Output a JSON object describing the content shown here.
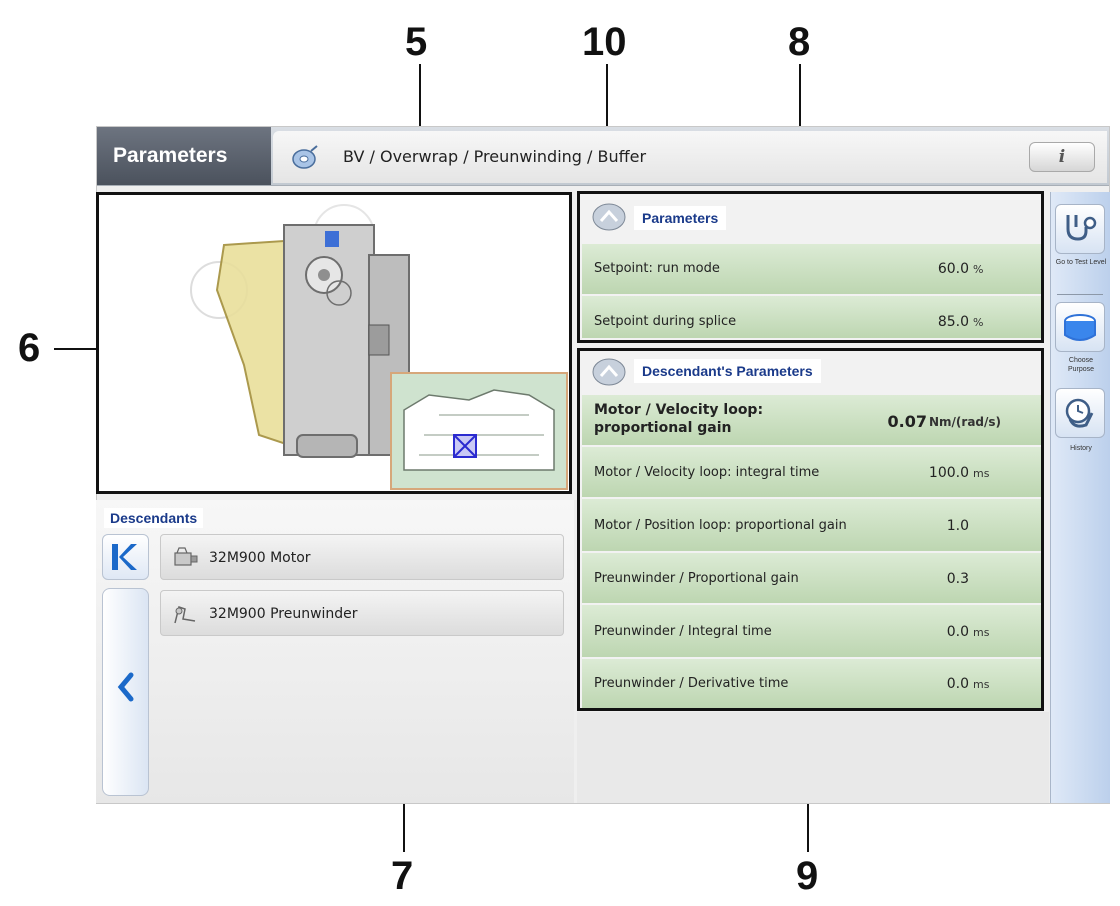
{
  "callouts": {
    "n5": "5",
    "n10": "10",
    "n8": "8",
    "n6": "6",
    "n7": "7",
    "n9": "9"
  },
  "header": {
    "title": "Parameters",
    "breadcrumb": "BV / Overwrap / Preunwinding / Buffer",
    "info_label": "i"
  },
  "descendants": {
    "header": "Descendants",
    "items": [
      {
        "label": "32M900  Motor",
        "icon": "motor-icon"
      },
      {
        "label": "32M900  Preunwinder",
        "icon": "preunwinder-icon"
      }
    ]
  },
  "parameters": {
    "header": "Parameters",
    "rows": [
      {
        "name": "Setpoint: run mode",
        "value": "60.0",
        "unit": "%"
      },
      {
        "name": "Setpoint during splice",
        "value": "85.0",
        "unit": "%"
      }
    ]
  },
  "descendant_parameters": {
    "header": "Descendant's Parameters",
    "rows": [
      {
        "name": "Motor / Velocity loop: proportional gain",
        "value": "0.07",
        "unit": "Nm/(rad/s)",
        "highlighted": true
      },
      {
        "name": "Motor / Velocity loop: integral time",
        "value": "100.0",
        "unit": "ms"
      },
      {
        "name": "Motor / Position loop: proportional gain",
        "value": "1.0",
        "unit": ""
      },
      {
        "name": "Preunwinder / Proportional gain",
        "value": "0.3",
        "unit": ""
      },
      {
        "name": "Preunwinder / Integral time",
        "value": "0.0",
        "unit": "ms"
      },
      {
        "name": "Preunwinder / Derivative time",
        "value": "0.0",
        "unit": "ms"
      }
    ]
  },
  "sidebar": {
    "items": [
      {
        "label": "Go to Test Level",
        "icon": "stethoscope-icon"
      },
      {
        "label": "Choose Purpose",
        "icon": "purpose-icon"
      },
      {
        "label": "History",
        "icon": "history-icon"
      }
    ]
  },
  "colors": {
    "row_green": "#c8dfbd",
    "header_blue": "#1a3a8a",
    "title_dark": "#555c67"
  }
}
